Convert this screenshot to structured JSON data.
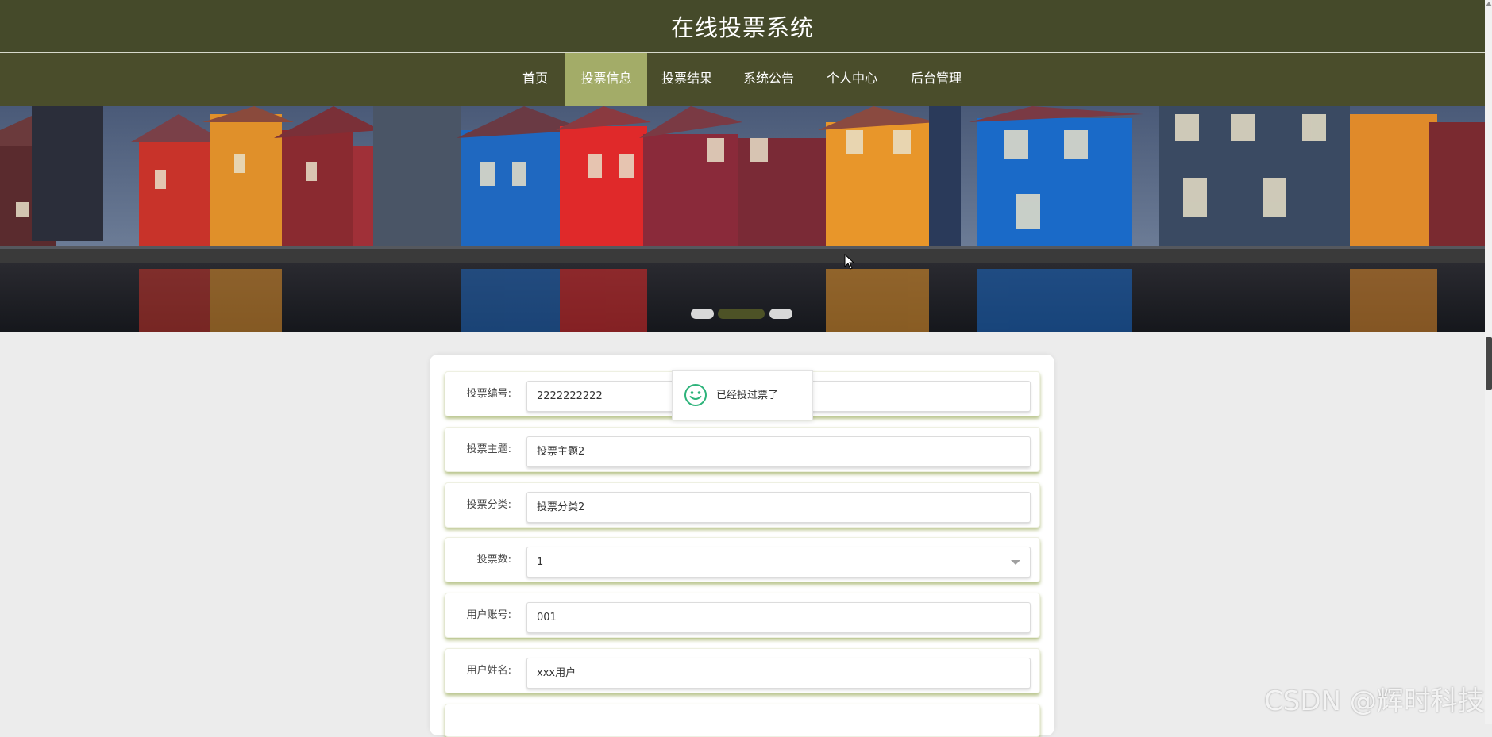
{
  "header": {
    "title": "在线投票系统"
  },
  "nav": {
    "items": [
      {
        "label": "首页"
      },
      {
        "label": "投票信息"
      },
      {
        "label": "投票结果"
      },
      {
        "label": "系统公告"
      },
      {
        "label": "个人中心"
      },
      {
        "label": "后台管理"
      }
    ],
    "active_index": 1
  },
  "banner": {
    "slide_count": 3,
    "active_slide": 2
  },
  "form": {
    "fields": [
      {
        "label": "投票编号:",
        "value": "2222222222"
      },
      {
        "label": "投票主题:",
        "value": "投票主题2"
      },
      {
        "label": "投票分类:",
        "value": "投票分类2"
      },
      {
        "label": "投票数:",
        "value": "1"
      },
      {
        "label": "用户账号:",
        "value": "001"
      },
      {
        "label": "用户姓名:",
        "value": "xxx用户"
      }
    ]
  },
  "toast": {
    "message": "已经投过票了",
    "icon": "smile-icon"
  },
  "watermark": {
    "text": "CSDN @辉时科技"
  },
  "colors": {
    "header_bg": "#454a2a",
    "nav_bg": "#4a4d2b",
    "nav_active": "#a3ac68",
    "row_shadow": "#a0b064",
    "toast_icon": "#2db37a"
  }
}
